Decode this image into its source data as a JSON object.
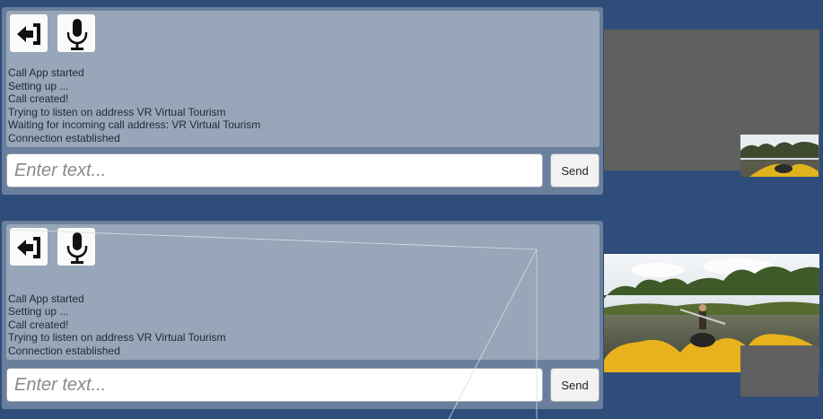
{
  "calls": [
    {
      "log": [
        "Call App started",
        "Setting up ...",
        "Call created!",
        "Trying to listen on address VR Virtual Tourism",
        "Waiting for incoming call address: VR Virtual Tourism",
        "Connection established"
      ],
      "input_placeholder": "Enter text...",
      "input_value": "",
      "send_label": "Send"
    },
    {
      "log": [
        "Call App started",
        "Setting up ...",
        "Call created!",
        "Trying to listen on address VR Virtual Tourism",
        "Connection established"
      ],
      "input_placeholder": "Enter text...",
      "input_value": "",
      "send_label": "Send"
    }
  ],
  "icons": {
    "exit": "exit-door-icon",
    "mic": "microphone-icon"
  },
  "colors": {
    "background": "#2e4d7b",
    "panel": "#6a7f9b",
    "log_area": "#97a6b8",
    "video_placeholder": "#606060"
  }
}
